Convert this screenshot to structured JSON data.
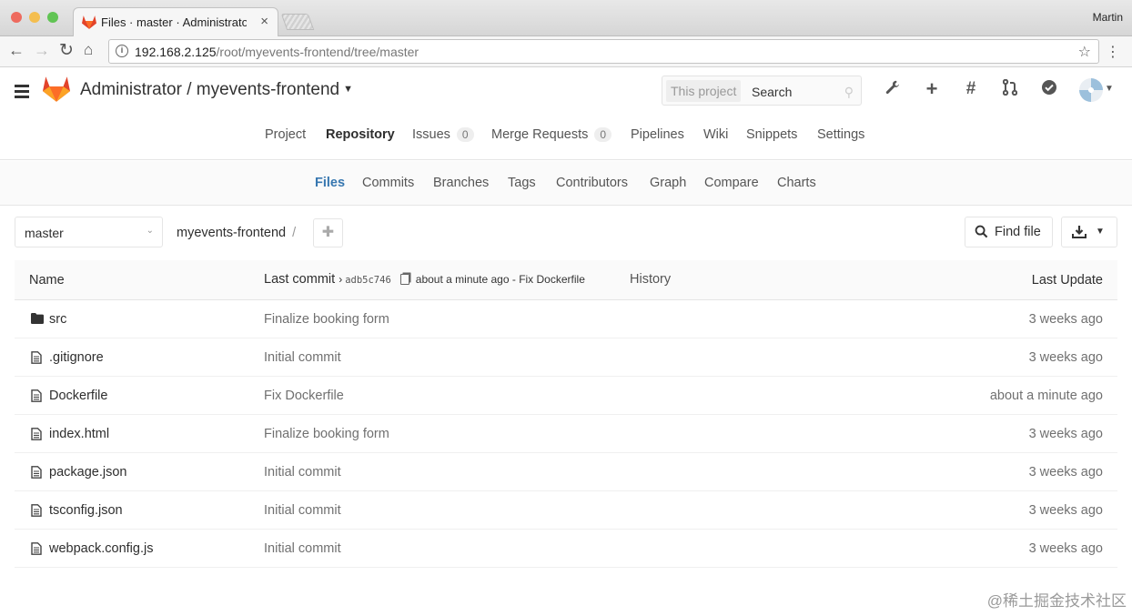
{
  "browser": {
    "tab_title": "Files · master · Administrator / ",
    "tab_close": "×",
    "user": "Martin",
    "url_host": "192.168.2.125",
    "url_path": "/root/myevents-frontend/tree/master",
    "traffic_colors": [
      "#ee6a5e",
      "#f4be4f",
      "#61c454"
    ]
  },
  "header": {
    "title": "Administrator / myevents-frontend",
    "search_scope": "This project",
    "search_placeholder": "Search",
    "icons": [
      "wrench-icon",
      "plus-icon",
      "hash-icon",
      "merge-request-icon",
      "todo-check-icon"
    ]
  },
  "project_nav": [
    {
      "label": "Project"
    },
    {
      "label": "Repository",
      "active": true
    },
    {
      "label": "Issues",
      "count": "0"
    },
    {
      "label": "Merge Requests",
      "count": "0"
    },
    {
      "label": "Pipelines"
    },
    {
      "label": "Wiki"
    },
    {
      "label": "Snippets"
    },
    {
      "label": "Settings"
    }
  ],
  "sub_nav": [
    {
      "label": "Files",
      "active": true
    },
    {
      "label": "Commits"
    },
    {
      "label": "Branches"
    },
    {
      "label": "Tags"
    },
    {
      "label": "Contributors"
    },
    {
      "label": "Graph"
    },
    {
      "label": "Compare"
    },
    {
      "label": "Charts"
    }
  ],
  "tree": {
    "branch": "master",
    "path": "myevents-frontend",
    "path_sep": "/",
    "find_file": "Find file"
  },
  "table": {
    "col_name": "Name",
    "col_commit": "Last commit",
    "commit_sha": "adb5c746",
    "commit_msg": "about a minute ago - Fix Dockerfile",
    "history": "History",
    "col_update": "Last Update",
    "rows": [
      {
        "name": "src",
        "type": "folder",
        "message": "Finalize booking form",
        "updated": "3 weeks ago"
      },
      {
        "name": ".gitignore",
        "type": "file",
        "message": "Initial commit",
        "updated": "3 weeks ago"
      },
      {
        "name": "Dockerfile",
        "type": "file",
        "message": "Fix Dockerfile",
        "updated": "about a minute ago"
      },
      {
        "name": "index.html",
        "type": "file",
        "message": "Finalize booking form",
        "updated": "3 weeks ago"
      },
      {
        "name": "package.json",
        "type": "file",
        "message": "Initial commit",
        "updated": "3 weeks ago"
      },
      {
        "name": "tsconfig.json",
        "type": "file",
        "message": "Initial commit",
        "updated": "3 weeks ago"
      },
      {
        "name": "webpack.config.js",
        "type": "file",
        "message": "Initial commit",
        "updated": "3 weeks ago"
      }
    ]
  },
  "watermark": "@稀土掘金技术社区"
}
